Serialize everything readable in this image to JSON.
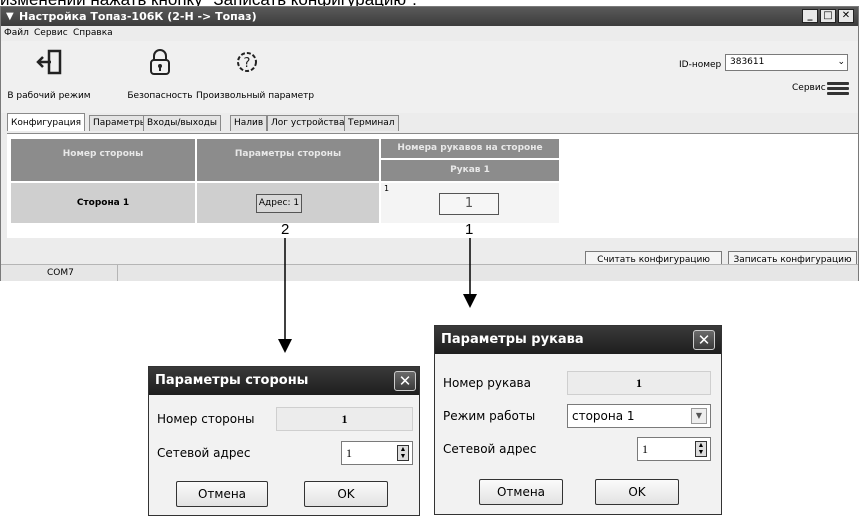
{
  "caption": "изменений нажать кнопку \"Записать конфигурацию\".",
  "window": {
    "title": "Настройка Топаз-106К (2-Н -> Топаз)",
    "menu": [
      "Файл",
      "Сервис",
      "Справка"
    ],
    "toolbar": {
      "work_mode": "В рабочий режим",
      "security": "Безопасность",
      "arbitrary_param": "Произвольный параметр",
      "id_label": "ID-номер",
      "id_value": "383611",
      "service_label": "Сервис"
    },
    "tabs": [
      "Конфигурация",
      "Параметры",
      "Входы/выходы",
      "Налив",
      "Лог устройства",
      "Терминал"
    ],
    "active_tab": "Конфигурация",
    "table": {
      "col_side_number": "Номер стороны",
      "col_side_params": "Параметры стороны",
      "col_hose_numbers": "Номера рукавов на стороне",
      "col_hose_1": "Рукав 1",
      "row_side": "Сторона 1",
      "row_address": "Адрес: 1",
      "row_hose_index": "1",
      "row_hose_value": "1"
    },
    "buttons": {
      "read_config": "Считать конфигурацию",
      "write_config": "Записать конфигурацию"
    },
    "status": {
      "port": "COM7"
    }
  },
  "annotations": {
    "marker_side": "2",
    "marker_hose": "1"
  },
  "dialog_side": {
    "title": "Параметры стороны",
    "side_number_label": "Номер стороны",
    "side_number_value": "1",
    "net_address_label": "Сетевой адрес",
    "net_address_value": "1",
    "cancel": "Отмена",
    "ok": "OK"
  },
  "dialog_hose": {
    "title": "Параметры рукава",
    "hose_number_label": "Номер рукава",
    "hose_number_value": "1",
    "mode_label": "Режим работы",
    "mode_value": "сторона 1",
    "net_address_label": "Сетевой адрес",
    "net_address_value": "1",
    "cancel": "Отмена",
    "ok": "OK"
  },
  "colors": {
    "titlebar": "#3c3c3c",
    "header_cell": "#8c8c8c",
    "data_cell": "#cfcfcf",
    "dialog_title": "#1e1e1e"
  },
  "icons": [
    "exit-door-icon",
    "padlock-icon",
    "gear-question-icon",
    "hamburger-menu-icon",
    "close-icon",
    "spin-arrows-icon",
    "dropdown-arrow-icon"
  ]
}
